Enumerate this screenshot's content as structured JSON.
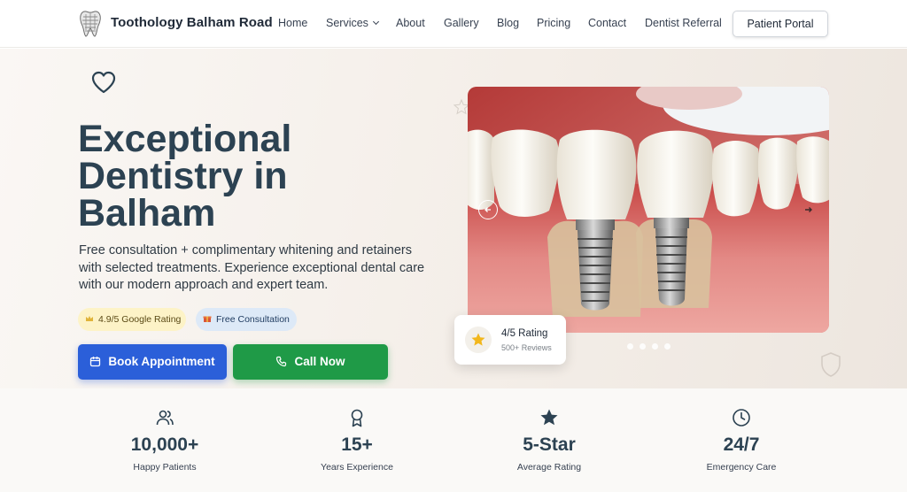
{
  "header": {
    "brand": "Toothology Balham Road",
    "nav": [
      {
        "label": "Home"
      },
      {
        "label": "Services",
        "has_dropdown": true
      },
      {
        "label": "About"
      },
      {
        "label": "Gallery"
      },
      {
        "label": "Blog"
      },
      {
        "label": "Pricing"
      },
      {
        "label": "Contact"
      },
      {
        "label": "Dentist Referral"
      }
    ],
    "portal_label": "Patient Portal"
  },
  "hero": {
    "title_lines": [
      "Exceptional",
      "Dentistry in",
      "Balham"
    ],
    "subtitle": "Free consultation + complimentary whitening and retainers with selected treatments. Experience exceptional dental care with our modern approach and expert team.",
    "badges": [
      {
        "label": "4.9/5 Google Rating",
        "icon": "crown-icon"
      },
      {
        "label": "Free Consultation",
        "icon": "gift-icon"
      }
    ],
    "buttons": {
      "book": "Book Appointment",
      "call": "Call Now"
    },
    "rating_card": {
      "title": "4/5 Rating",
      "subtitle": "500+ Reviews"
    },
    "carousel": {
      "slide_count": 4,
      "active_slide": 1
    }
  },
  "stats": [
    {
      "value": "10,000+",
      "label": "Happy Patients",
      "icon": "users-icon"
    },
    {
      "value": "15+",
      "label": "Years Experience",
      "icon": "award-icon"
    },
    {
      "value": "5-Star",
      "label": "Average Rating",
      "icon": "star-icon"
    },
    {
      "value": "24/7",
      "label": "Emergency Care",
      "icon": "clock-icon"
    }
  ],
  "colors": {
    "heading": "#2c4252",
    "primary_blue": "#2b5fd9",
    "call_green": "#1f9a47",
    "rating_badge_bg": "#fdf3c7",
    "consult_badge_bg": "#dde9f7"
  }
}
